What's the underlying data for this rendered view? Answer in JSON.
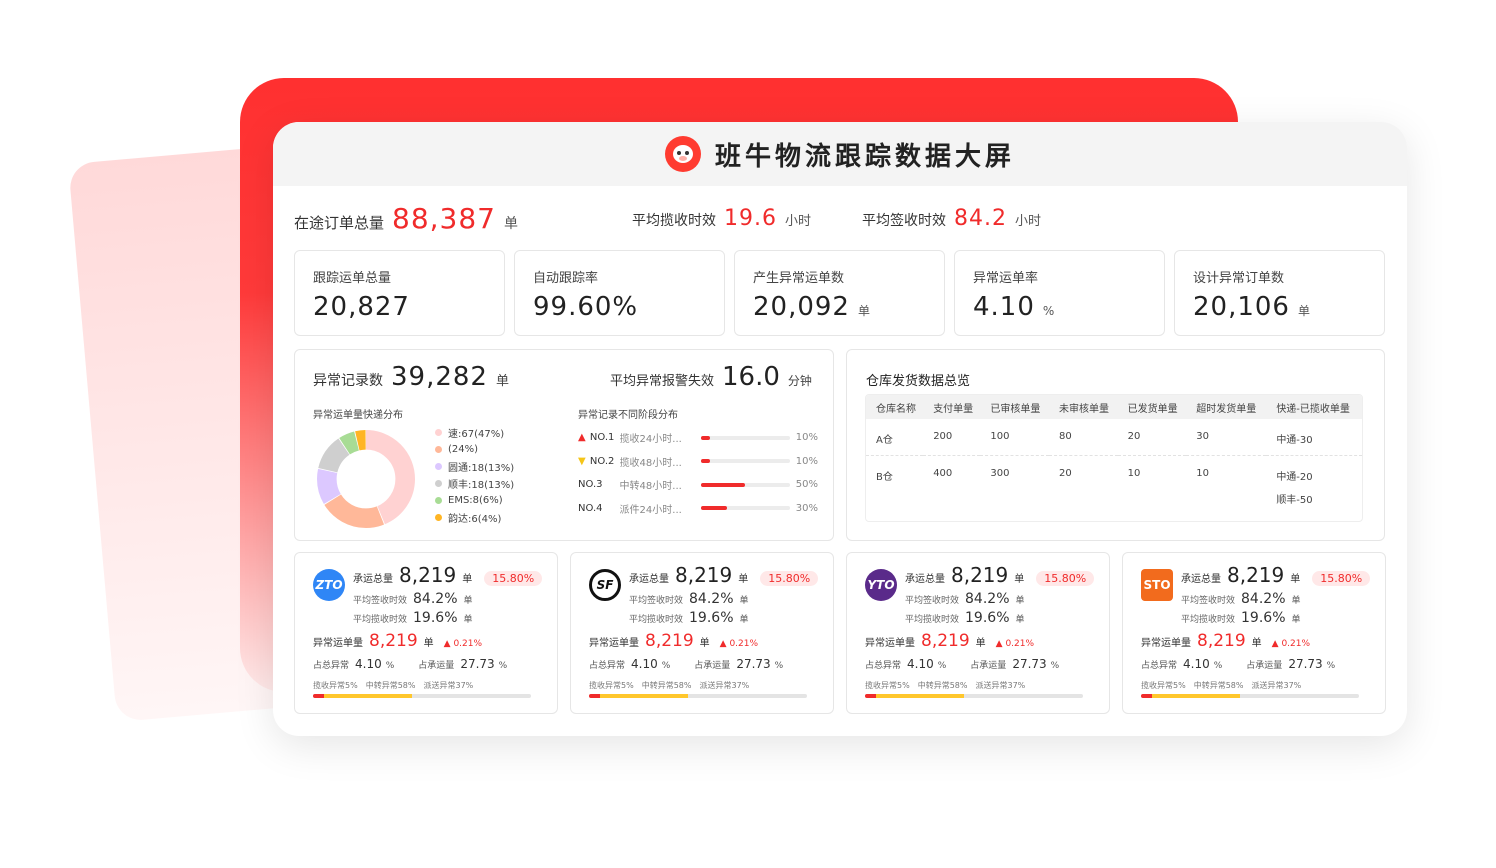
{
  "header": {
    "title": "班牛物流跟踪数据大屏",
    "logo_icon": "cow-logo-icon"
  },
  "summary": {
    "in_transit_label": "在途订单总量",
    "in_transit_value": "88,387",
    "in_transit_unit": "单",
    "avg_pickup_label": "平均揽收时效",
    "avg_pickup_value": "19.6",
    "avg_pickup_unit": "小时",
    "avg_sign_label": "平均签收时效",
    "avg_sign_value": "84.2",
    "avg_sign_unit": "小时"
  },
  "kpis": [
    {
      "label": "跟踪运单总量",
      "value": "20,827",
      "unit": ""
    },
    {
      "label": "自动跟踪率",
      "value": "99.60%",
      "unit": ""
    },
    {
      "label": "产生异常运单数",
      "value": "20,092",
      "unit": "单"
    },
    {
      "label": "异常运单率",
      "value": "4.10",
      "unit": "%"
    },
    {
      "label": "设计异常订单数",
      "value": "20,106",
      "unit": "单"
    }
  ],
  "abnormal": {
    "records_label": "异常记录数",
    "records_value": "39,282",
    "records_unit": "单",
    "alarm_label": "平均异常报警失效",
    "alarm_value": "16.0",
    "alarm_unit": "分钟",
    "dist_title": "异常运单量快递分布",
    "stage_title": "异常记录不同阶段分布",
    "distribution": [
      {
        "label": "速:67(47%)",
        "percent": 47,
        "color": "#ffd2d2"
      },
      {
        "label": "(24%)",
        "percent": 24,
        "color": "#ffb899"
      },
      {
        "label": "圆通:18(13%)",
        "percent": 13,
        "color": "#dcc8ff"
      },
      {
        "label": "顺丰:18(13%)",
        "percent": 13,
        "color": "#cfcfcf"
      },
      {
        "label": "EMS:8(6%)",
        "percent": 6,
        "color": "#a8dc95"
      },
      {
        "label": "韵达:6(4%)",
        "percent": 4,
        "color": "#ffb524"
      }
    ],
    "stages": [
      {
        "no": "NO.1",
        "text": "揽收24小时...",
        "percent": 10,
        "pct_label": "10%",
        "marker": "▲",
        "marker_color": "#f02b2b"
      },
      {
        "no": "NO.2",
        "text": "揽收48小时...",
        "percent": 10,
        "pct_label": "10%",
        "marker": "▼",
        "marker_color": "#f5c518"
      },
      {
        "no": "NO.3",
        "text": "中转48小时...",
        "percent": 50,
        "pct_label": "50%",
        "marker": "",
        "marker_color": ""
      },
      {
        "no": "NO.4",
        "text": "派件24小时...",
        "percent": 30,
        "pct_label": "30%",
        "marker": "",
        "marker_color": ""
      }
    ]
  },
  "warehouse": {
    "title": "仓库发货数据总览",
    "columns": [
      "仓库名称",
      "支付单量",
      "已审核单量",
      "未审核单量",
      "已发货单量",
      "超时发货单量",
      "快递-已揽收单量"
    ],
    "rows": [
      [
        "A仓",
        "200",
        "100",
        "80",
        "20",
        "30",
        "中通-30"
      ],
      [
        "B仓",
        "400",
        "300",
        "20",
        "10",
        "10",
        "中通-20"
      ]
    ],
    "extra": "顺丰-50"
  },
  "carriers": [
    {
      "logo_text": "ZTO",
      "logo_color": "#2f86f6",
      "logo_icon": "zto-logo-icon"
    },
    {
      "logo_text": "SF",
      "logo_color": "#222222",
      "logo_icon": "sf-logo-icon"
    },
    {
      "logo_text": "YTO",
      "logo_color": "#5a2a8a",
      "logo_icon": "yto-logo-icon"
    },
    {
      "logo_text": "STO",
      "logo_color": "#f26b1d",
      "logo_icon": "sto-logo-icon"
    }
  ],
  "carrier_stats": {
    "total_label": "承运总量",
    "total_value": "8,219",
    "total_unit": "单",
    "badge": "15.80%",
    "sign_label": "平均签收时效",
    "sign_value": "84.2%",
    "sign_unit": "单",
    "pickup_label": "平均揽收时效",
    "pickup_value": "19.6%",
    "pickup_unit": "单",
    "abn_label": "异常运单量",
    "abn_value": "8,219",
    "abn_unit": "单",
    "abn_delta": "▲ 0.21%",
    "share_abn_label": "占总异常",
    "share_abn_value": "4.10",
    "share_abn_unit": "%",
    "share_total_label": "占承运量",
    "share_total_value": "27.73",
    "share_total_unit": "%",
    "stage1": "揽收异常5%",
    "stage2": "中转异常58%",
    "stage3": "派送异常37%",
    "stage1_pct": 5,
    "stage2_pct": 58
  }
}
